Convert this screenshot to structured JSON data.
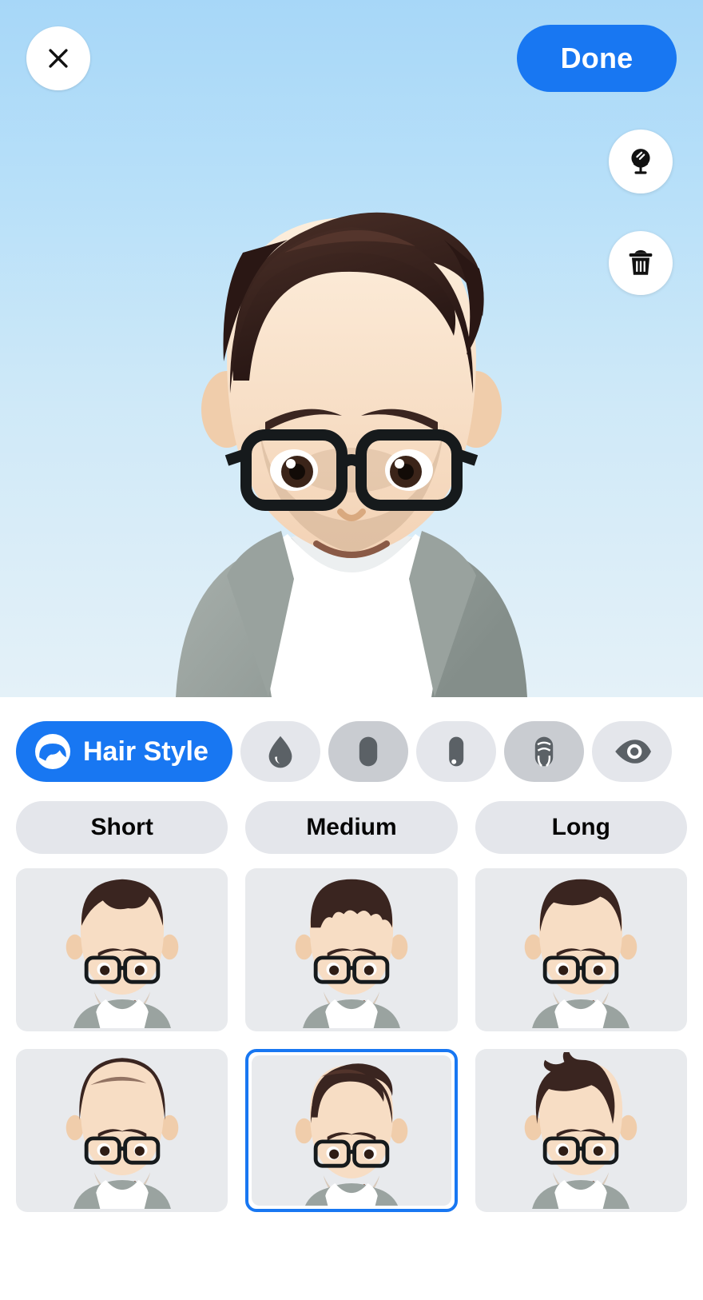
{
  "header": {
    "close_label": "Close",
    "close_icon": "close-icon",
    "done_label": "Done"
  },
  "side_actions": [
    {
      "name": "mirror-button",
      "icon": "mirror-icon",
      "label": "Mirror"
    },
    {
      "name": "delete-button",
      "icon": "trash-icon",
      "label": "Delete"
    }
  ],
  "avatar": {
    "description": "Male cartoon avatar, dark brown quiff hair, black rectangular glasses, light stubble beard, grey blazer over white v-neck tee",
    "skin": "#f7ddc4",
    "hair": "#38221d",
    "jacket": "#9aa3a0",
    "shirt": "#ffffff",
    "glasses": "#161a1c",
    "background_top": "#a7d7f8",
    "background_bottom": "#e4f1f8"
  },
  "tabs": [
    {
      "label": "Hair Style",
      "icon": "hair-style-icon",
      "active": true,
      "dim": false
    },
    {
      "label": "Hair Color",
      "icon": "droplet-icon",
      "active": false,
      "dim": false
    },
    {
      "label": "Face Shape",
      "icon": "face-shape-icon",
      "active": false,
      "dim": true
    },
    {
      "label": "Skin Tone",
      "icon": "skin-tone-icon",
      "active": false,
      "dim": false
    },
    {
      "label": "Facial Hair",
      "icon": "facial-hair-icon",
      "active": false,
      "dim": true
    },
    {
      "label": "Eyes",
      "icon": "eye-icon",
      "active": false,
      "dim": false
    }
  ],
  "length_filters": [
    {
      "label": "Short",
      "selected": false
    },
    {
      "label": "Medium",
      "selected": false
    },
    {
      "label": "Long",
      "selected": false
    }
  ],
  "styles": [
    {
      "id": "style-1",
      "name": "Short textured crop",
      "selected": false,
      "hair": "crop"
    },
    {
      "id": "style-2",
      "name": "Short fringe",
      "selected": false,
      "hair": "fringe"
    },
    {
      "id": "style-3",
      "name": "Short side part",
      "selected": false,
      "hair": "sidepart"
    },
    {
      "id": "style-4",
      "name": "Slicked back",
      "selected": false,
      "hair": "slick"
    },
    {
      "id": "style-5",
      "name": "Quiff undercut",
      "selected": true,
      "hair": "quiff"
    },
    {
      "id": "style-6",
      "name": "Spiky quiff",
      "selected": false,
      "hair": "spiky"
    }
  ],
  "colors": {
    "accent": "#1877f2",
    "chip": "#e4e6eb",
    "chip_dim": "#c9ccd1",
    "tile": "#e8eaed",
    "text": "#050505"
  }
}
